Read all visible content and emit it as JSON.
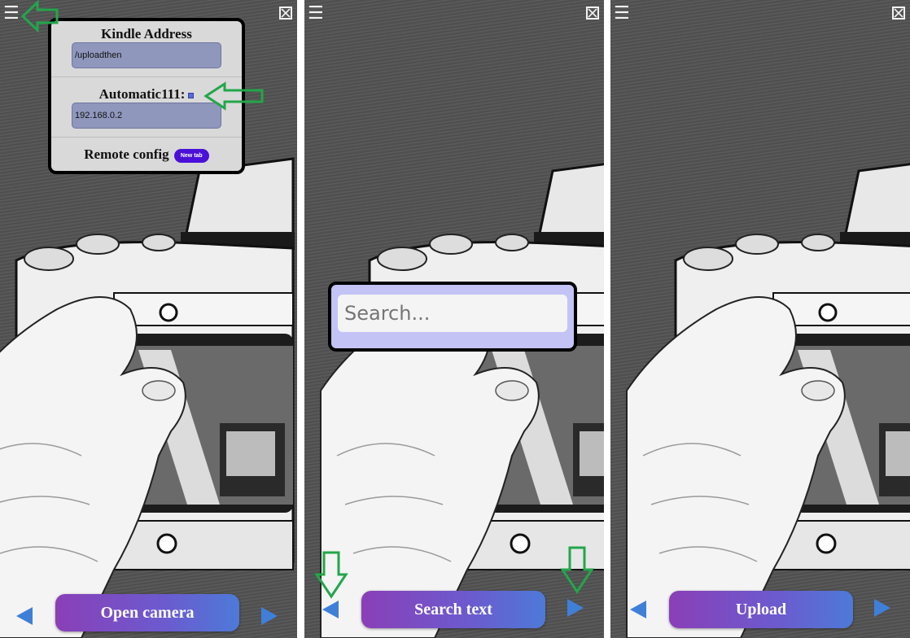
{
  "icons": {
    "menu": "hamburger-menu-icon",
    "close": "close-box-icon",
    "prev": "left-triangle-icon",
    "next": "right-triangle-icon"
  },
  "colors": {
    "button_gradient_start": "#8a3fb7",
    "button_gradient_end": "#4d7ad8",
    "arrow_blue": "#3f7fd8",
    "annotation_green": "#22a64a",
    "new_tab_purple": "#4b10d8"
  },
  "panels": [
    {
      "menu_glyph": "☰",
      "action_label": "Open camera",
      "settings": {
        "kindle_title": "Kindle Address",
        "kindle_value": "/uploadthen",
        "auto_title": "Automatic111:",
        "auto_value": "192.168.0.2",
        "remote_title": "Remote config",
        "new_tab_label": "New tab"
      }
    },
    {
      "menu_glyph": "☰",
      "action_label": "Search text",
      "search_placeholder": "Search..."
    },
    {
      "menu_glyph": "☰",
      "action_label": "Upload"
    }
  ]
}
